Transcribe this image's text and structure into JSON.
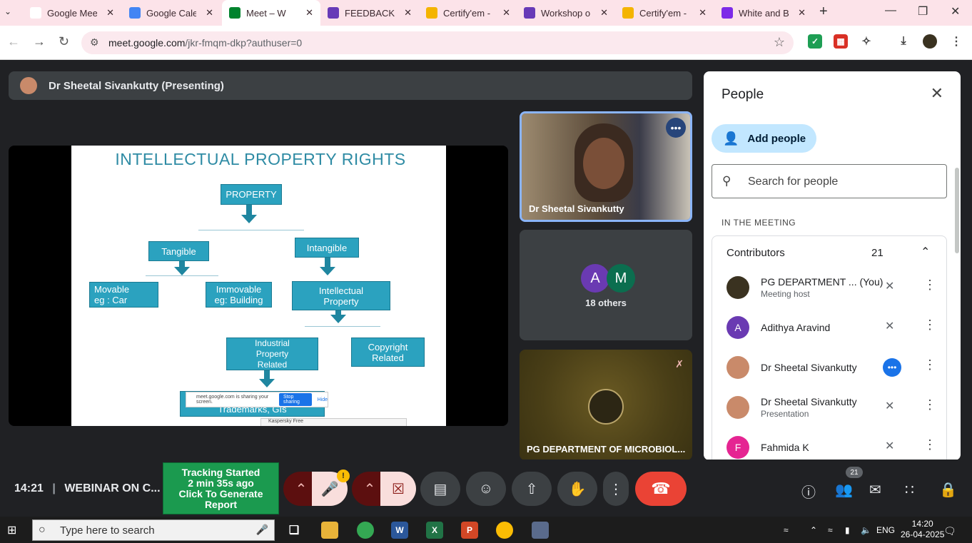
{
  "browser": {
    "tabs": [
      {
        "title": "Google Meet",
        "icon": "meet-icon",
        "color": "#ffffff"
      },
      {
        "title": "Google Calendar",
        "icon": "calendar-icon",
        "color": "#4285f4"
      },
      {
        "title": "Meet – W",
        "icon": "meet-icon",
        "color": "#00832d",
        "active": true
      },
      {
        "title": "FEEDBACK FO",
        "icon": "forms-icon",
        "color": "#673ab7"
      },
      {
        "title": "Certify'em -",
        "icon": "slides-icon",
        "color": "#f4b400"
      },
      {
        "title": "Workshop on",
        "icon": "forms-icon",
        "color": "#673ab7"
      },
      {
        "title": "Certify'em -",
        "icon": "slides-icon",
        "color": "#f4b400"
      },
      {
        "title": "White and B",
        "icon": "canva-icon",
        "color": "#7d2ae8"
      }
    ],
    "url_host": "meet.google.com",
    "url_path": "/jkr-fmqm-dkp?authuser=0"
  },
  "meet": {
    "presenter_banner": "Dr Sheetal Sivankutty (Presenting)",
    "slide": {
      "title": "INTELLECTUAL PROPERTY RIGHTS",
      "nodes": {
        "property": "PROPERTY",
        "tangible": "Tangible",
        "intangible": "Intangible",
        "movable": "Movable\neg : Car",
        "immovable": "Immovable\neg: Building",
        "intellectual": "Intellectual\nProperty",
        "industrial": "Industrial\nProperty\nRelated",
        "copyright": "Copyright\nRelated",
        "trademarks": "Trademarks, GIs"
      },
      "share_notice": "meet.google.com is sharing your screen.",
      "stop_sharing": "Stop sharing",
      "hide": "Hide",
      "kaspersky": "Kaspersky Free"
    },
    "tiles": {
      "presenter_name": "Dr Sheetal Sivankutty",
      "others_label": "18 others",
      "others_avatars": [
        {
          "letter": "A",
          "color": "#6a3ab2"
        },
        {
          "letter": "M",
          "color": "#0b6e4f"
        }
      ],
      "department_name": "PG DEPARTMENT OF MICROBIOL..."
    },
    "clock": "14:21",
    "meeting_title": "WEBINAR ON C...",
    "tracking": {
      "line1": "Tracking Started",
      "line2": "2 min 35s ago",
      "line3": "Click To Generate Report"
    },
    "warning_mark": "!",
    "participant_badge": "21"
  },
  "people": {
    "title": "People",
    "add_label": "Add people",
    "search_placeholder": "Search for people",
    "section": "IN THE MEETING",
    "group_label": "Contributors",
    "group_count": "21",
    "rows": [
      {
        "name": "PG DEPARTMENT ... (You)",
        "sub": "Meeting host",
        "avatar": "logo",
        "color": "#3a3220"
      },
      {
        "name": "Adithya Aravind",
        "sub": "",
        "avatar": "A",
        "color": "#6a3ab2"
      },
      {
        "name": "Dr Sheetal Sivankutty",
        "sub": "",
        "avatar": "photo",
        "color": "#c98a6a"
      },
      {
        "name": "Dr Sheetal Sivankutty",
        "sub": "Presentation",
        "avatar": "photo",
        "color": "#c98a6a"
      },
      {
        "name": "Fahmida K",
        "sub": "",
        "avatar": "F",
        "color": "#e52592"
      }
    ]
  },
  "taskbar": {
    "search_placeholder": "Type here to search",
    "lang": "ENG",
    "time": "14:20",
    "date": "26-04-2025"
  }
}
